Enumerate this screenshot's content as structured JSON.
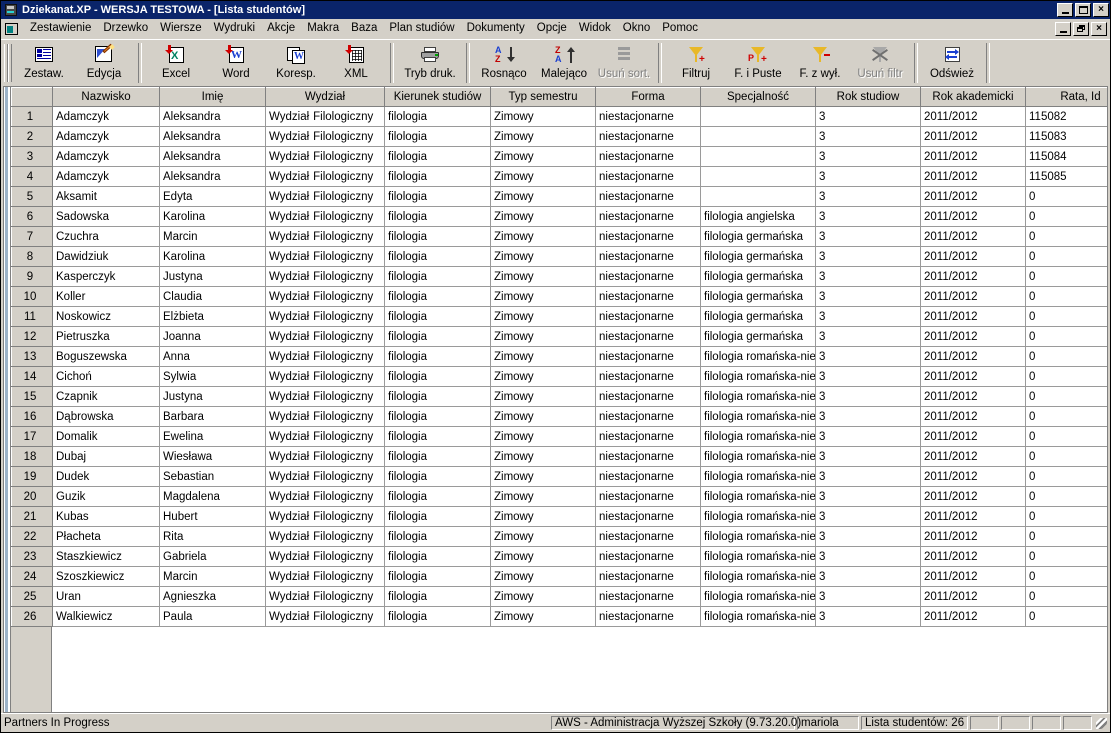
{
  "window": {
    "title": "Dziekanat.XP - WERSJA TESTOWA - [Lista studentów]",
    "app_icon": "app-icon",
    "buttons": {
      "minimize": "minimize",
      "maximize": "maximize",
      "close": "close"
    },
    "mdi_buttons": {
      "minimize": "minimize",
      "restore": "restore",
      "close": "close"
    }
  },
  "menu": {
    "items": [
      {
        "label": "Zestawienie"
      },
      {
        "label": "Drzewko"
      },
      {
        "label": "Wiersze"
      },
      {
        "label": "Wydruki"
      },
      {
        "label": "Akcje"
      },
      {
        "label": "Makra"
      },
      {
        "label": "Baza"
      },
      {
        "label": "Plan studiów"
      },
      {
        "label": "Dokumenty"
      },
      {
        "label": "Opcje"
      },
      {
        "label": "Widok"
      },
      {
        "label": "Okno"
      },
      {
        "label": "Pomoc"
      }
    ]
  },
  "toolbar": {
    "buttons": [
      {
        "label": "Zestaw.",
        "icon": "report-icon",
        "disabled": false
      },
      {
        "label": "Edycja",
        "icon": "edit-page-icon",
        "disabled": false
      },
      {
        "label": "Excel",
        "icon": "excel-export-icon",
        "disabled": false
      },
      {
        "label": "Word",
        "icon": "word-export-icon",
        "disabled": false
      },
      {
        "label": "Koresp.",
        "icon": "mail-merge-icon",
        "disabled": false
      },
      {
        "label": "XML",
        "icon": "xml-export-icon",
        "disabled": false
      },
      {
        "label": "Tryb druk.",
        "icon": "printer-icon",
        "disabled": false
      },
      {
        "label": "Rosnąco",
        "icon": "sort-ascending-icon",
        "disabled": false
      },
      {
        "label": "Malejąco",
        "icon": "sort-descending-icon",
        "disabled": false
      },
      {
        "label": "Usuń sort.",
        "icon": "clear-sort-icon",
        "disabled": true
      },
      {
        "label": "Filtruj",
        "icon": "filter-icon",
        "disabled": false
      },
      {
        "label": "F. i Puste",
        "icon": "filter-empty-icon",
        "disabled": false
      },
      {
        "label": "F. z wył.",
        "icon": "filter-exclude-icon",
        "disabled": false
      },
      {
        "label": "Usuń filtr",
        "icon": "clear-filter-icon",
        "disabled": true
      },
      {
        "label": "Odśwież",
        "icon": "refresh-icon",
        "disabled": false
      }
    ]
  },
  "grid": {
    "columns": [
      "",
      "Nazwisko",
      "Imię",
      "Wydział",
      "Kierunek studiów",
      "Typ semestru",
      "Forma",
      "Specjalność",
      "Rok studiow",
      "Rok akademicki",
      "Rata, Id"
    ],
    "rows": [
      [
        "1",
        "Adamczyk",
        "Aleksandra",
        "Wydział  Filologiczny",
        "filologia",
        "Zimowy",
        "niestacjonarne",
        "",
        "3",
        "2011/2012",
        "115082"
      ],
      [
        "2",
        "Adamczyk",
        "Aleksandra",
        "Wydział  Filologiczny",
        "filologia",
        "Zimowy",
        "niestacjonarne",
        "",
        "3",
        "2011/2012",
        "115083"
      ],
      [
        "3",
        "Adamczyk",
        "Aleksandra",
        "Wydział  Filologiczny",
        "filologia",
        "Zimowy",
        "niestacjonarne",
        "",
        "3",
        "2011/2012",
        "115084"
      ],
      [
        "4",
        "Adamczyk",
        "Aleksandra",
        "Wydział  Filologiczny",
        "filologia",
        "Zimowy",
        "niestacjonarne",
        "",
        "3",
        "2011/2012",
        "115085"
      ],
      [
        "5",
        "Aksamit",
        "Edyta",
        "Wydział  Filologiczny",
        "filologia",
        "Zimowy",
        "niestacjonarne",
        "",
        "3",
        "2011/2012",
        "0"
      ],
      [
        "6",
        "Sadowska",
        "Karolina",
        "Wydział  Filologiczny",
        "filologia",
        "Zimowy",
        "niestacjonarne",
        "filologia angielska",
        "3",
        "2011/2012",
        "0"
      ],
      [
        "7",
        "Czuchra",
        "Marcin",
        "Wydział  Filologiczny",
        "filologia",
        "Zimowy",
        "niestacjonarne",
        "filologia germańska",
        "3",
        "2011/2012",
        "0"
      ],
      [
        "8",
        "Dawidziuk",
        "Karolina",
        "Wydział  Filologiczny",
        "filologia",
        "Zimowy",
        "niestacjonarne",
        "filologia germańska",
        "3",
        "2011/2012",
        "0"
      ],
      [
        "9",
        "Kasperczyk",
        "Justyna",
        "Wydział  Filologiczny",
        "filologia",
        "Zimowy",
        "niestacjonarne",
        "filologia germańska",
        "3",
        "2011/2012",
        "0"
      ],
      [
        "10",
        "Koller",
        "Claudia",
        "Wydział  Filologiczny",
        "filologia",
        "Zimowy",
        "niestacjonarne",
        "filologia germańska",
        "3",
        "2011/2012",
        "0"
      ],
      [
        "11",
        "Noskowicz",
        "Elżbieta",
        "Wydział  Filologiczny",
        "filologia",
        "Zimowy",
        "niestacjonarne",
        "filologia germańska",
        "3",
        "2011/2012",
        "0"
      ],
      [
        "12",
        "Pietruszka",
        "Joanna",
        "Wydział  Filologiczny",
        "filologia",
        "Zimowy",
        "niestacjonarne",
        "filologia germańska",
        "3",
        "2011/2012",
        "0"
      ],
      [
        "13",
        "Boguszewska",
        "Anna",
        "Wydział  Filologiczny",
        "filologia",
        "Zimowy",
        "niestacjonarne",
        "filologia romańska-nie",
        "3",
        "2011/2012",
        "0"
      ],
      [
        "14",
        "Cichoń",
        "Sylwia",
        "Wydział  Filologiczny",
        "filologia",
        "Zimowy",
        "niestacjonarne",
        "filologia romańska-nie",
        "3",
        "2011/2012",
        "0"
      ],
      [
        "15",
        "Czapnik",
        "Justyna",
        "Wydział  Filologiczny",
        "filologia",
        "Zimowy",
        "niestacjonarne",
        "filologia romańska-nie",
        "3",
        "2011/2012",
        "0"
      ],
      [
        "16",
        "Dąbrowska",
        "Barbara",
        "Wydział  Filologiczny",
        "filologia",
        "Zimowy",
        "niestacjonarne",
        "filologia romańska-nie",
        "3",
        "2011/2012",
        "0"
      ],
      [
        "17",
        "Domalik",
        "Ewelina",
        "Wydział  Filologiczny",
        "filologia",
        "Zimowy",
        "niestacjonarne",
        "filologia romańska-nie",
        "3",
        "2011/2012",
        "0"
      ],
      [
        "18",
        "Dubaj",
        "Wiesława",
        "Wydział  Filologiczny",
        "filologia",
        "Zimowy",
        "niestacjonarne",
        "filologia romańska-nie",
        "3",
        "2011/2012",
        "0"
      ],
      [
        "19",
        "Dudek",
        "Sebastian",
        "Wydział  Filologiczny",
        "filologia",
        "Zimowy",
        "niestacjonarne",
        "filologia romańska-nie",
        "3",
        "2011/2012",
        "0"
      ],
      [
        "20",
        "Guzik",
        "Magdalena",
        "Wydział  Filologiczny",
        "filologia",
        "Zimowy",
        "niestacjonarne",
        "filologia romańska-nie",
        "3",
        "2011/2012",
        "0"
      ],
      [
        "21",
        "Kubas",
        "Hubert",
        "Wydział  Filologiczny",
        "filologia",
        "Zimowy",
        "niestacjonarne",
        "filologia romańska-nie",
        "3",
        "2011/2012",
        "0"
      ],
      [
        "22",
        "Płacheta",
        "Rita",
        "Wydział  Filologiczny",
        "filologia",
        "Zimowy",
        "niestacjonarne",
        "filologia romańska-nie",
        "3",
        "2011/2012",
        "0"
      ],
      [
        "23",
        "Staszkiewicz",
        "Gabriela",
        "Wydział  Filologiczny",
        "filologia",
        "Zimowy",
        "niestacjonarne",
        "filologia romańska-nie",
        "3",
        "2011/2012",
        "0"
      ],
      [
        "24",
        "Szoszkiewicz",
        "Marcin",
        "Wydział  Filologiczny",
        "filologia",
        "Zimowy",
        "niestacjonarne",
        "filologia romańska-nie",
        "3",
        "2011/2012",
        "0"
      ],
      [
        "25",
        "Uran",
        "Agnieszka",
        "Wydział  Filologiczny",
        "filologia",
        "Zimowy",
        "niestacjonarne",
        "filologia romańska-nie",
        "3",
        "2011/2012",
        "0"
      ],
      [
        "26",
        "Walkiewicz",
        "Paula",
        "Wydział  Filologiczny",
        "filologia",
        "Zimowy",
        "niestacjonarne",
        "filologia romańska-nie",
        "3",
        "2011/2012",
        "0"
      ]
    ]
  },
  "status": {
    "left": "Partners In Progress",
    "system": "AWS - Administracja Wyższej Szkoły (9.73.20.0)",
    "user": "mariola",
    "count": "Lista studentów: 26"
  },
  "colors": {
    "titlebar": "#0a246a",
    "chrome": "#d4d0c8",
    "grid_line": "#9a9a9a",
    "disabled_text": "#808080"
  }
}
